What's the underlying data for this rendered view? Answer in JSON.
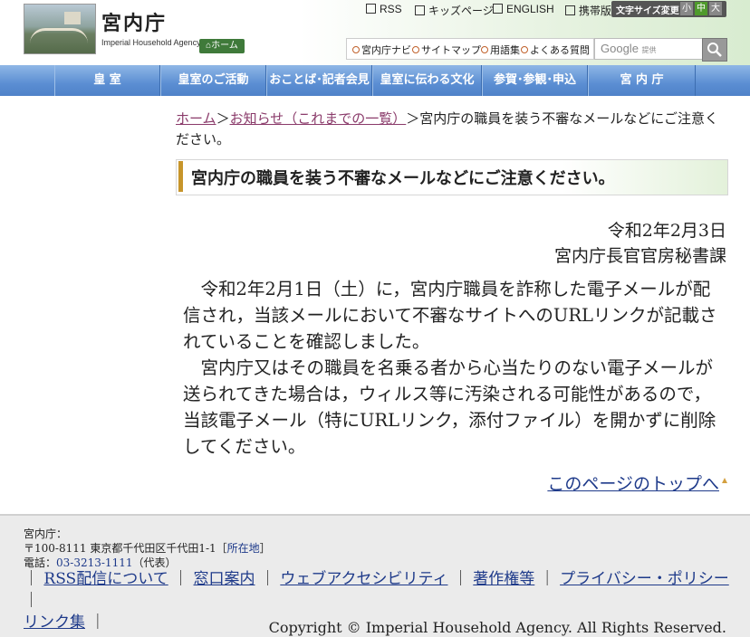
{
  "header": {
    "site_title": "宮内庁",
    "site_subtitle": "Imperial Household Agency",
    "home_button": "ホーム",
    "top_links": [
      "RSS",
      "キッズページ",
      "ENGLISH",
      "携帯版"
    ],
    "font_size_label": "文字サイズ変更",
    "font_sizes": [
      "小",
      "中",
      "大"
    ],
    "sub_links": [
      "宮内庁ナビ",
      "サイトマップ",
      "用語集",
      "よくある質問"
    ],
    "search_placeholder_brand": "Google",
    "search_placeholder_suffix": "提供"
  },
  "nav": [
    "皇 室",
    "皇室のご活動",
    "おことば･記者会見",
    "皇室に伝わる文化",
    "参賀･参観･申込",
    "宮 内 庁"
  ],
  "breadcrumb": {
    "home": "ホーム",
    "parent": "お知らせ（これまでの一覧）",
    "current": "宮内庁の職員を装う不審なメールなどにご注意ください。"
  },
  "article": {
    "title": "宮内庁の職員を装う不審なメールなどにご注意ください。",
    "date": "令和2年2月3日",
    "org": "宮内庁長官官房秘書課",
    "paragraphs": [
      "令和2年2月1日（土）に，宮内庁職員を詐称した電子メールが配信され，当該メールにおいて不審なサイトへのURLリンクが記載されていることを確認しました。",
      "宮内庁又はその職員を名乗る者から心当たりのない電子メールが送られてきた場合は，ウィルス等に汚染される可能性があるので，当該電子メール（特にURLリンク，添付ファイル）を開かずに削除してください。"
    ],
    "to_top": "このページのトップへ"
  },
  "footer": {
    "org_label": "宮内庁：",
    "address": "〒100-8111 東京都千代田区千代田1-1［",
    "address_link": "所在地",
    "address_end": "］",
    "phone_label": "電話：",
    "phone": "03-3213-1111",
    "phone_suffix": "（代表）",
    "links": [
      "RSS配信について",
      "窓口案内",
      "ウェブアクセシビリティ",
      "著作権等",
      "プライバシー・ポリシー",
      "リンク集"
    ],
    "copyright": "Copyright © Imperial Household Agency. All Rights Reserved."
  }
}
